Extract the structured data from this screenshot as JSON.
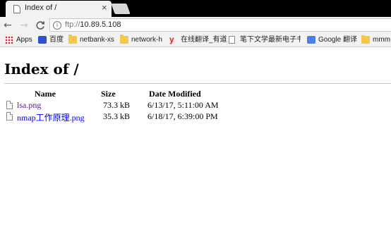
{
  "browser": {
    "tab_title": "Index of /",
    "tab_close_glyph": "×",
    "url_scheme": "ftp://",
    "url_host": "10.89.5.108",
    "nav": {
      "back_glyph": "←",
      "forward_glyph": "→",
      "reload_glyph": "C"
    },
    "bookmarks": [
      {
        "label": "Apps",
        "icon": "apps-icon"
      },
      {
        "label": "百度",
        "icon": "baidu-icon"
      },
      {
        "label": "netbank-xs",
        "icon": "folder-icon"
      },
      {
        "label": "network-h",
        "icon": "folder-icon"
      },
      {
        "label": "在线翻译_有道",
        "icon": "youdao-icon"
      },
      {
        "label": "笔下文学最新电子书",
        "icon": "page-icon"
      },
      {
        "label": "Google 翻译",
        "icon": "google-translate-icon"
      },
      {
        "label": "mmm",
        "icon": "folder-icon"
      }
    ]
  },
  "page": {
    "heading": "Index of /",
    "columns": {
      "name": "Name",
      "size": "Size",
      "date": "Date Modified"
    },
    "files": [
      {
        "name": "lsa.png",
        "size": "73.3 kB",
        "date": "6/13/17, 5:11:00 AM",
        "link_color": "#551a8b"
      },
      {
        "name": "nmap工作原理.png",
        "size": "35.3 kB",
        "date": "6/18/17, 6:39:00 PM",
        "link_color": "#0000ee"
      }
    ]
  },
  "colors": {
    "visited_link": "#551a8b",
    "link": "#0000ee",
    "chrome_bg": "#f2f2f2"
  }
}
